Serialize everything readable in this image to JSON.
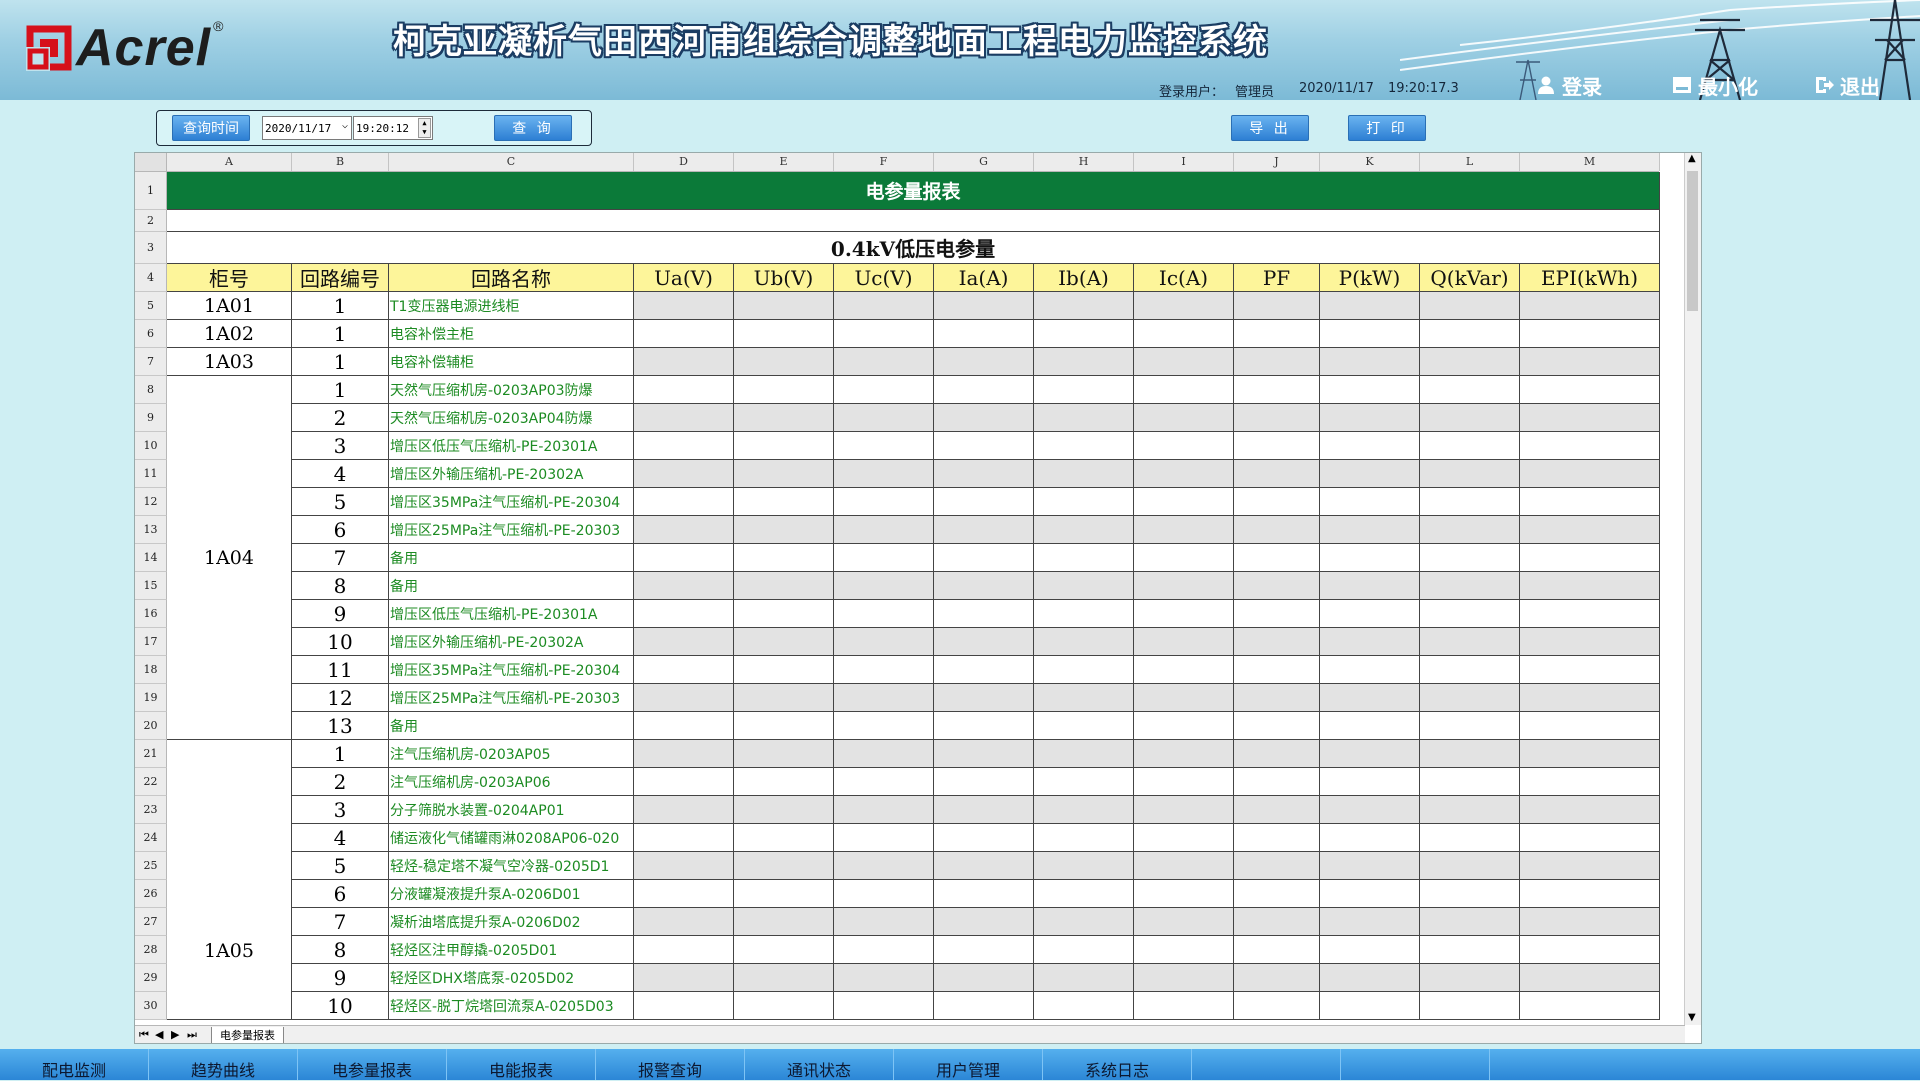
{
  "header": {
    "logo_text": "Acrel",
    "logo_reg": "®",
    "title": "柯克亚凝析气田西河甫组综合调整地面工程电力监控系统",
    "user_label": "登录用户：",
    "user_name": "管理员",
    "date": "2020/11/17",
    "time": "19:20:17.3",
    "login_label": "登录",
    "minimize_label": "最小化",
    "exit_label": "退出"
  },
  "query": {
    "time_label": "查询时间",
    "date_value": "2020/11/17",
    "time_value": "19:20:12",
    "query_label": "查 询",
    "export_label": "导 出",
    "print_label": "打 印"
  },
  "sheet": {
    "columns": [
      "A",
      "B",
      "C",
      "D",
      "E",
      "F",
      "G",
      "H",
      "I",
      "J",
      "K",
      "L",
      "M"
    ],
    "report_title": "电参量报表",
    "subtitle": "0.4kV低压电参量",
    "headers": [
      "柜号",
      "回路编号",
      "回路名称",
      "Ua(V)",
      "Ub(V)",
      "Uc(V)",
      "Ia(A)",
      "Ib(A)",
      "Ic(A)",
      "PF",
      "P(kW)",
      "Q(kVar)",
      "EPI(kWh)"
    ],
    "rows": [
      {
        "no": "1",
        "name": "T1变压器电源进线柜"
      },
      {
        "no": "1",
        "name": "电容补偿主柜"
      },
      {
        "no": "1",
        "name": "电容补偿辅柜"
      },
      {
        "no": "1",
        "name": "天然气压缩机房-0203AP03防爆"
      },
      {
        "no": "2",
        "name": "天然气压缩机房-0203AP04防爆"
      },
      {
        "no": "3",
        "name": "增压区低压气压缩机-PE-20301A"
      },
      {
        "no": "4",
        "name": "增压区外输压缩机-PE-20302A"
      },
      {
        "no": "5",
        "name": "增压区35MPa注气压缩机-PE-20304"
      },
      {
        "no": "6",
        "name": "增压区25MPa注气压缩机-PE-20303"
      },
      {
        "no": "7",
        "name": "备用"
      },
      {
        "no": "8",
        "name": "备用"
      },
      {
        "no": "9",
        "name": "增压区低压气压缩机-PE-20301A"
      },
      {
        "no": "10",
        "name": "增压区外输压缩机-PE-20302A"
      },
      {
        "no": "11",
        "name": "增压区35MPa注气压缩机-PE-20304"
      },
      {
        "no": "12",
        "name": "增压区25MPa注气压缩机-PE-20303"
      },
      {
        "no": "13",
        "name": "备用"
      },
      {
        "no": "1",
        "name": "注气压缩机房-0203AP05"
      },
      {
        "no": "2",
        "name": "注气压缩机房-0203AP06"
      },
      {
        "no": "3",
        "name": "分子筛脱水装置-0204AP01"
      },
      {
        "no": "4",
        "name": "储运液化气储罐雨淋0208AP06-020"
      },
      {
        "no": "5",
        "name": "轻烃-稳定塔不凝气空冷器-0205D1"
      },
      {
        "no": "6",
        "name": "分液罐凝液提升泵A-0206D01"
      },
      {
        "no": "7",
        "name": "凝析油塔底提升泵A-0206D02"
      },
      {
        "no": "8",
        "name": "轻烃区注甲醇撬-0205D01"
      },
      {
        "no": "9",
        "name": "轻烃区DHX塔底泵-0205D02"
      },
      {
        "no": "10",
        "name": "轻烃区-脱丁烷塔回流泵A-0205D03"
      }
    ],
    "cabinets": [
      "1A01",
      "1A02",
      "1A03",
      "1A04",
      "1A05"
    ],
    "row_numbers": [
      "1",
      "2",
      "3",
      "4",
      "5",
      "6",
      "7",
      "8",
      "9",
      "10",
      "11",
      "12",
      "13",
      "14",
      "15",
      "16",
      "17",
      "18",
      "19",
      "20",
      "21",
      "22",
      "23",
      "24",
      "25",
      "26",
      "27",
      "28",
      "29",
      "30"
    ],
    "tab_name": "电参量报表"
  },
  "nav": {
    "items": [
      "配电监测",
      "趋势曲线",
      "电参量报表",
      "电能报表",
      "报警查询",
      "通讯状态",
      "用户管理",
      "系统日志",
      "",
      ""
    ]
  }
}
